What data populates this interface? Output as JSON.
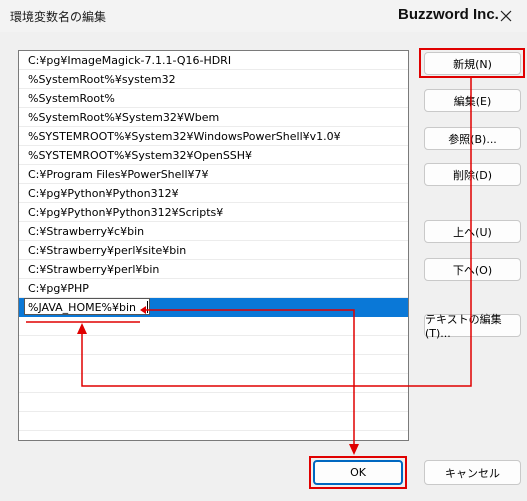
{
  "window": {
    "title": "環境変数名の編集",
    "brand": "Buzzword Inc.",
    "close_icon": "close-icon"
  },
  "list": {
    "items": [
      "C:¥pg¥ImageMagick-7.1.1-Q16-HDRI",
      "%SystemRoot%¥system32",
      "%SystemRoot%",
      "%SystemRoot%¥System32¥Wbem",
      "%SYSTEMROOT%¥System32¥WindowsPowerShell¥v1.0¥",
      "%SYSTEMROOT%¥System32¥OpenSSH¥",
      "C:¥Program Files¥PowerShell¥7¥",
      "C:¥pg¥Python¥Python312¥",
      "C:¥pg¥Python¥Python312¥Scripts¥",
      "C:¥Strawberry¥c¥bin",
      "C:¥Strawberry¥perl¥site¥bin",
      "C:¥Strawberry¥perl¥bin",
      "C:¥pg¥PHP"
    ],
    "editing_value": "%JAVA_HOME%¥bin"
  },
  "buttons": {
    "new": "新規(N)",
    "edit": "編集(E)",
    "browse": "参照(B)...",
    "delete": "削除(D)",
    "up": "上へ(U)",
    "down": "下へ(O)",
    "edit_text": "テキストの編集(T)...",
    "ok": "OK",
    "cancel": "キャンセル"
  },
  "colors": {
    "selection": "#0a78d7",
    "annotation": "#e00000",
    "ok_border": "#0067c0"
  }
}
